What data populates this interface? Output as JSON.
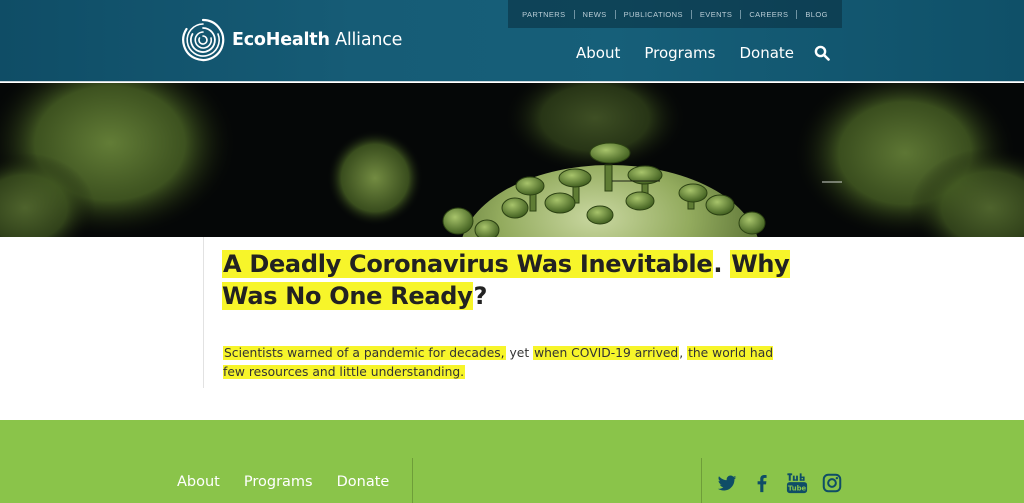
{
  "header": {
    "logo_text_bold": "EcoHealth",
    "logo_text_regular": " Alliance",
    "utility_links": [
      "PARTNERS",
      "NEWS",
      "PUBLICATIONS",
      "EVENTS",
      "CAREERS",
      "BLOG"
    ],
    "main_nav": [
      "About",
      "Programs",
      "Donate"
    ],
    "search_icon": "search-icon"
  },
  "article": {
    "headline_parts": [
      {
        "text": "A Deadly Coronavirus Was Inevitable",
        "highlight": true
      },
      {
        "text": ". ",
        "highlight": false
      },
      {
        "text": "Why Was No One Ready",
        "highlight": true
      },
      {
        "text": "?",
        "highlight": false
      }
    ],
    "dek_parts": [
      {
        "text": "Scientists warned of a pandemic for decades,",
        "highlight": true
      },
      {
        "text": " yet ",
        "highlight": false
      },
      {
        "text": "when COVID-19 arrived",
        "highlight": true
      },
      {
        "text": ", ",
        "highlight": false
      },
      {
        "text": "the world had few resources and little understanding.",
        "highlight": true
      }
    ],
    "highlight_color": "#f7f52a"
  },
  "footer": {
    "nav": [
      "About",
      "Programs",
      "Donate"
    ],
    "social_icons": [
      "twitter-icon",
      "facebook-icon",
      "youtube-icon",
      "instagram-icon"
    ],
    "background_color": "#8ac44a"
  },
  "colors": {
    "header_bg": "#165c76",
    "footer_bg": "#8ac44a",
    "highlight": "#f7f52a"
  }
}
